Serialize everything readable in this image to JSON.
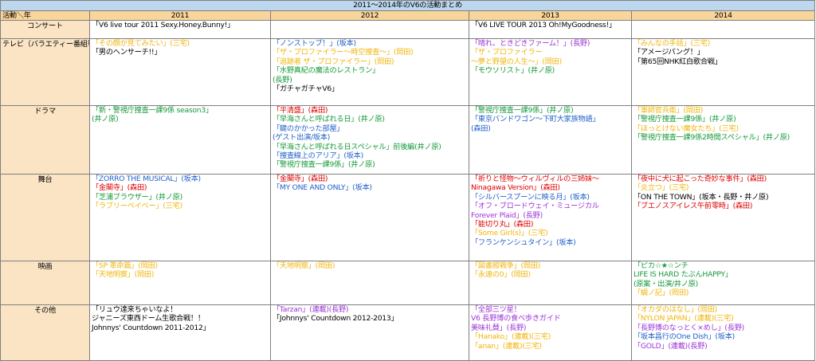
{
  "title": "2011～2014年のV6の活動まとめ",
  "header": {
    "corner": "活動＼年",
    "years": [
      "2011",
      "2012",
      "2013",
      "2014"
    ]
  },
  "colors": {
    "black": "#000000",
    "red": "#e00000",
    "blue": "#1f5fc9",
    "green": "#159a3a",
    "yellow": "#f1b50a",
    "purple": "#9b35d6",
    "orange": "#e36c09",
    "header_bg": "#f8d59a",
    "category_bg": "#fbe4c4",
    "title_bg": "#bdd7ee"
  },
  "rows": [
    {
      "category": "コンサート",
      "cells": [
        [
          {
            "text": "「V6 live tour 2011 Sexy.Honey.Bunny!」",
            "color": "black"
          }
        ],
        [],
        [
          {
            "text": "「V6 LIVE TOUR 2013 Oh!MyGoodness!」",
            "color": "black"
          }
        ],
        []
      ]
    },
    {
      "category": "テレビ（バラエティー番組等）",
      "cells": [
        [
          {
            "text": "「その顔が見てみたい」(三宅)",
            "color": "yellow"
          },
          {
            "text": "「男のヘンサーチ!!」",
            "color": "black"
          }
        ],
        [
          {
            "text": "「ノンストップ！」(坂本)",
            "color": "blue"
          },
          {
            "text": "「ザ・プロファイラー～時空捜査～」(岡田)",
            "color": "yellow"
          },
          {
            "text": "「追跡者 ザ・プロファイラー」(岡田)",
            "color": "yellow"
          },
          {
            "text": "「水野真紀の魔法のレストラン」",
            "color": "green"
          },
          {
            "text": "(長野)",
            "color": "green"
          },
          {
            "text": "「ガチャガチャV6」",
            "color": "black"
          }
        ],
        [
          {
            "text": "「晴れ、ときどきファーム！」(長野)",
            "color": "purple"
          },
          {
            "text": "「ザ・プロファイラー",
            "color": "yellow"
          },
          {
            "text": "～夢と野望の人生～」(岡田)",
            "color": "yellow"
          },
          {
            "text": "「モウソリスト」(井ノ原)",
            "color": "green"
          }
        ],
        [
          {
            "text": "「みんなの手話」(三宅)",
            "color": "yellow"
          },
          {
            "text": "「アメージパング！」",
            "color": "black"
          },
          {
            "text": "「第65回NHK紅白歌合戦」",
            "color": "black"
          }
        ]
      ]
    },
    {
      "category": "ドラマ",
      "cells": [
        [
          {
            "text": "「新・警視庁捜査一課9係 season3」",
            "color": "green"
          },
          {
            "text": "(井ノ原)",
            "color": "green"
          }
        ],
        [
          {
            "text": "「平清盛」(森田)",
            "color": "red"
          },
          {
            "text": "「早海さんと呼ばれる日」(井ノ原)",
            "color": "green"
          },
          {
            "text": "「鍵のかかった部屋」",
            "color": "blue"
          },
          {
            "text": "(ゲスト出演/坂本)",
            "color": "blue"
          },
          {
            "text": "「早海さんと呼ばれる日スペシャル」前後編(井ノ原)",
            "color": "green"
          },
          {
            "text": "「捜査線上のアリア」(坂本)",
            "color": "blue"
          },
          {
            "text": "「警視庁捜査一課9係」(井ノ原)",
            "color": "green"
          }
        ],
        [
          {
            "text": "「警視庁捜査一課9係」(井ノ原)",
            "color": "green"
          },
          {
            "text": "「東京バンドワゴン～下町大家族物語」",
            "color": "blue"
          },
          {
            "text": "(森田)",
            "color": "blue"
          }
        ],
        [
          {
            "text": "「軍師官兵衛」(岡田)",
            "color": "yellow"
          },
          {
            "text": "「警視庁捜査一課9係」(井ノ原)",
            "color": "green"
          },
          {
            "text": "「ほっとけない魔女たち」(三宅)",
            "color": "yellow"
          },
          {
            "text": "「警視庁捜査一課9係2時間スペシャル」(井ノ原)",
            "color": "green"
          }
        ]
      ]
    },
    {
      "category": "舞台",
      "cells": [
        [
          {
            "text": "「ZORRO THE MUSICAL」(坂本)",
            "color": "blue"
          },
          {
            "text": "「金閣寺」(森田)",
            "color": "red"
          },
          {
            "text": "「芝浦ブラウザー」(井ノ原)",
            "color": "green"
          },
          {
            "text": "「ラブリーベイベー」(三宅)",
            "color": "yellow"
          }
        ],
        [
          {
            "text": "「金閣寺」(森田)",
            "color": "red"
          },
          {
            "text": "「MY ONE AND ONLY」(坂本)",
            "color": "blue"
          }
        ],
        [
          {
            "text": "「祈りと怪物～ウィルヴィルの三姉妹～",
            "color": "red"
          },
          {
            "text": "Ninagawa Version」(森田)",
            "color": "red"
          },
          {
            "text": "「シルバースプーンに映る月」(坂本)",
            "color": "blue"
          },
          {
            "text": "「オフ・ブロードウェイ・ミュージカル",
            "color": "purple"
          },
          {
            "text": "  Forever Plaid」(長野)",
            "color": "purple"
          },
          {
            "text": "「能切り丸」(森田)",
            "color": "red"
          },
          {
            "text": "「Some Girl(s)」(三宅)",
            "color": "yellow"
          },
          {
            "text": "「フランケンシュタイン」(坂本)",
            "color": "blue"
          }
        ],
        [
          {
            "text": "「夜中に犬に起こった奇妙な事件」(森田)",
            "color": "red"
          },
          {
            "text": "「炎立つ」(三宅)",
            "color": "yellow"
          },
          {
            "text": "「ON THE TOWN」(坂本・長野・井ノ原)",
            "color": "black"
          },
          {
            "text": "「ブエノスアイレス午前零時」(森田)",
            "color": "red"
          }
        ]
      ]
    },
    {
      "category": "映画",
      "cells": [
        [
          {
            "text": "「SP 革命篇」(岡田)",
            "color": "yellow"
          },
          {
            "text": "「天地明察」(岡田)",
            "color": "yellow"
          }
        ],
        [
          {
            "text": "「天地明察」(岡田)",
            "color": "yellow"
          }
        ],
        [
          {
            "text": "「図書館戦争」(岡田)",
            "color": "yellow"
          },
          {
            "text": "「永遠の0」(岡田)",
            "color": "yellow"
          }
        ],
        [
          {
            "text": "「ピカ☆★☆ンチ",
            "color": "green"
          },
          {
            "text": "LIFE IS HARD たぶんHAPPY」",
            "color": "green"
          },
          {
            "text": "(原案・出演/井ノ原)",
            "color": "green"
          },
          {
            "text": "「蜩ノ記」(岡田)",
            "color": "yellow"
          }
        ]
      ]
    },
    {
      "category": "その他",
      "cells": [
        [
          {
            "text": "「リュウ達来ちゃいなよ！",
            "color": "black"
          },
          {
            "text": "ジャニーズ東西ドーム生歌合戦！！",
            "color": "black"
          },
          {
            "text": "Johnnys' Countdown 2011-2012」",
            "color": "black"
          }
        ],
        [
          {
            "text": "「Tarzan」(連載)(長野)",
            "color": "purple"
          },
          {
            "text": "「Johnnys' Countdown 2012-2013」",
            "color": "black"
          }
        ],
        [
          {
            "text": "「全部三ツ星！",
            "color": "purple"
          },
          {
            "text": "V6 長野博の食べ歩きガイド",
            "color": "purple"
          },
          {
            "text": "美味礼賛」(長野)",
            "color": "purple"
          },
          {
            "text": "「Hanako」(連載)(三宅)",
            "color": "yellow"
          },
          {
            "text": "「anan」(連載)(三宅)",
            "color": "yellow"
          }
        ],
        [
          {
            "text": "「オカダのはなし」(岡田)",
            "color": "yellow"
          },
          {
            "text": "「NYLON JAPAN」(連載)(三宅)",
            "color": "yellow"
          },
          {
            "text": "「長野博のなっとく×めし」(長野)",
            "color": "purple"
          },
          {
            "text": "「坂本昌行のOne Dish」(坂本)",
            "color": "blue"
          },
          {
            "text": "「GOLD」(連載)(長野)",
            "color": "purple"
          }
        ]
      ]
    }
  ]
}
